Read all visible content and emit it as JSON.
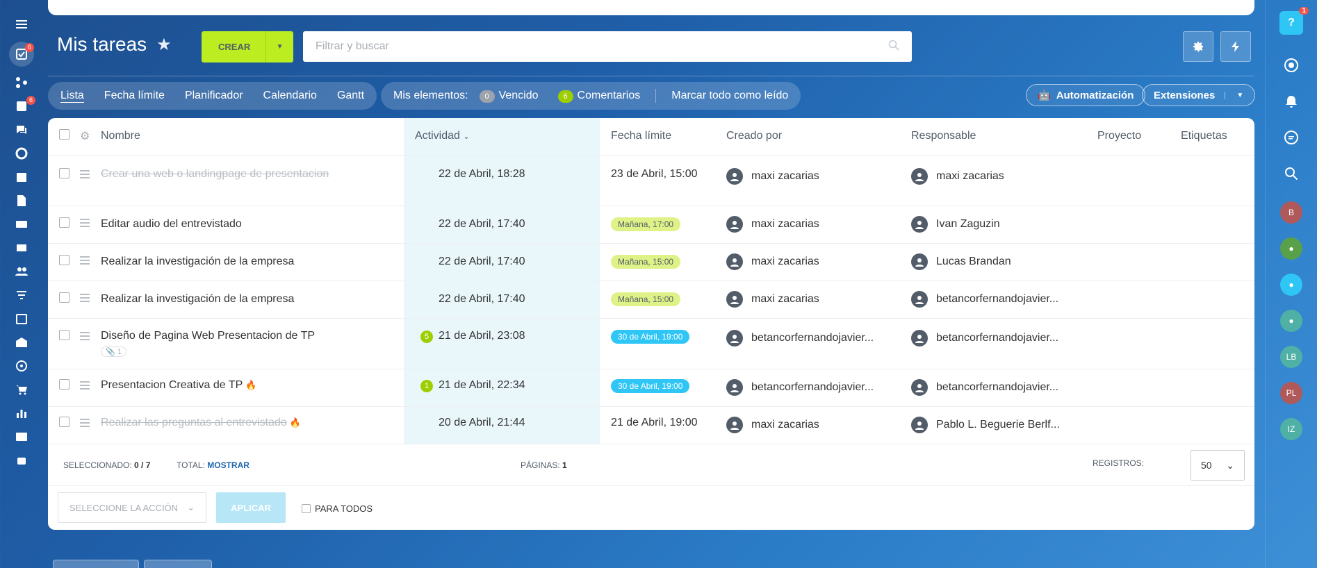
{
  "page": {
    "title": "Mis tareas",
    "create_label": "CREAR",
    "search_placeholder": "Filtrar y buscar"
  },
  "views": [
    "Lista",
    "Fecha límite",
    "Planificador",
    "Calendario",
    "Gantt"
  ],
  "my_items": {
    "label": "Mis elementos:",
    "overdue_count": "0",
    "overdue_label": "Vencido",
    "comments_count": "6",
    "comments_label": "Comentarios",
    "mark_all": "Marcar todo como leído"
  },
  "buttons": {
    "automation": "Automatización",
    "extensions": "Extensiones"
  },
  "columns": [
    "Nombre",
    "Actividad",
    "Fecha límite",
    "Creado por",
    "Responsable",
    "Proyecto",
    "Etiquetas"
  ],
  "tasks": [
    {
      "name": "Crear una web o landingpage de presentacion",
      "done": true,
      "activity": "22 de Abril, 18:28",
      "deadline": "23 de Abril, 15:00",
      "deadline_style": "plain",
      "creator": "maxi zacarias",
      "responsible": "maxi zacarias"
    },
    {
      "name": "Editar audio del entrevistado",
      "done": false,
      "activity": "22 de Abril, 17:40",
      "deadline": "Mañana, 17:00",
      "deadline_style": "green",
      "creator": "maxi zacarias",
      "responsible": "Ivan Zaguzin"
    },
    {
      "name": "Realizar la investigación de la empresa",
      "done": false,
      "activity": "22 de Abril, 17:40",
      "deadline": "Mañana, 15:00",
      "deadline_style": "green",
      "creator": "maxi zacarias",
      "responsible": "Lucas Brandan"
    },
    {
      "name": "Realizar la investigación de la empresa",
      "done": false,
      "activity": "22 de Abril, 17:40",
      "deadline": "Mañana, 15:00",
      "deadline_style": "green",
      "creator": "maxi zacarias",
      "responsible": "betancorfernandojavier..."
    },
    {
      "name": "Diseño de Pagina Web Presentacion de TP",
      "done": false,
      "activity_count": "5",
      "attachments": "1",
      "activity": "21 de Abril, 23:08",
      "deadline": "30 de Abril, 19:00",
      "deadline_style": "blue",
      "creator": "betancorfernandojavier...",
      "responsible": "betancorfernandojavier..."
    },
    {
      "name": "Presentacion Creativa de TP",
      "done": false,
      "hot": true,
      "activity_count": "1",
      "activity": "21 de Abril, 22:34",
      "deadline": "30 de Abril, 19:00",
      "deadline_style": "blue",
      "creator": "betancorfernandojavier...",
      "responsible": "betancorfernandojavier..."
    },
    {
      "name": "Realizar las preguntas al entrevistado",
      "done": true,
      "hot": true,
      "activity": "20 de Abril, 21:44",
      "deadline": "21 de Abril, 19:00",
      "deadline_style": "plain",
      "creator": "maxi zacarias",
      "responsible": "Pablo L. Beguerie Berlf..."
    }
  ],
  "footer": {
    "selected_label": "SELECCIONADO:",
    "selected_value": "0 / 7",
    "total_label": "TOTAL:",
    "total_link": "MOSTRAR",
    "pages_label": "PÁGINAS:",
    "pages_value": "1",
    "records_label": "REGISTROS:",
    "records_value": "50",
    "action_placeholder": "SELECCIONE LA ACCIÓN",
    "apply_label": "APLICAR",
    "for_all_label": "PARA TODOS"
  },
  "left_badges": {
    "tasks": "6",
    "feed": "6"
  },
  "right_bar": {
    "help_badge": "1",
    "avatars": [
      {
        "initials": "B",
        "color": "#b0595a"
      },
      {
        "initials": "",
        "color": "#58a14a"
      },
      {
        "initials": "",
        "color": "#2fc6f6"
      },
      {
        "initials": "",
        "color": "#4fb0a5"
      },
      {
        "initials": "LB",
        "color": "#4fb0a5"
      },
      {
        "initials": "PL",
        "color": "#b0595a"
      },
      {
        "initials": "IZ",
        "color": "#4fb0a5"
      }
    ]
  },
  "colors": {
    "accent_green": "#bbed21",
    "link_blue": "#2067b0",
    "deadline_blue": "#2fc6f6",
    "deadline_green": "#dff287"
  }
}
